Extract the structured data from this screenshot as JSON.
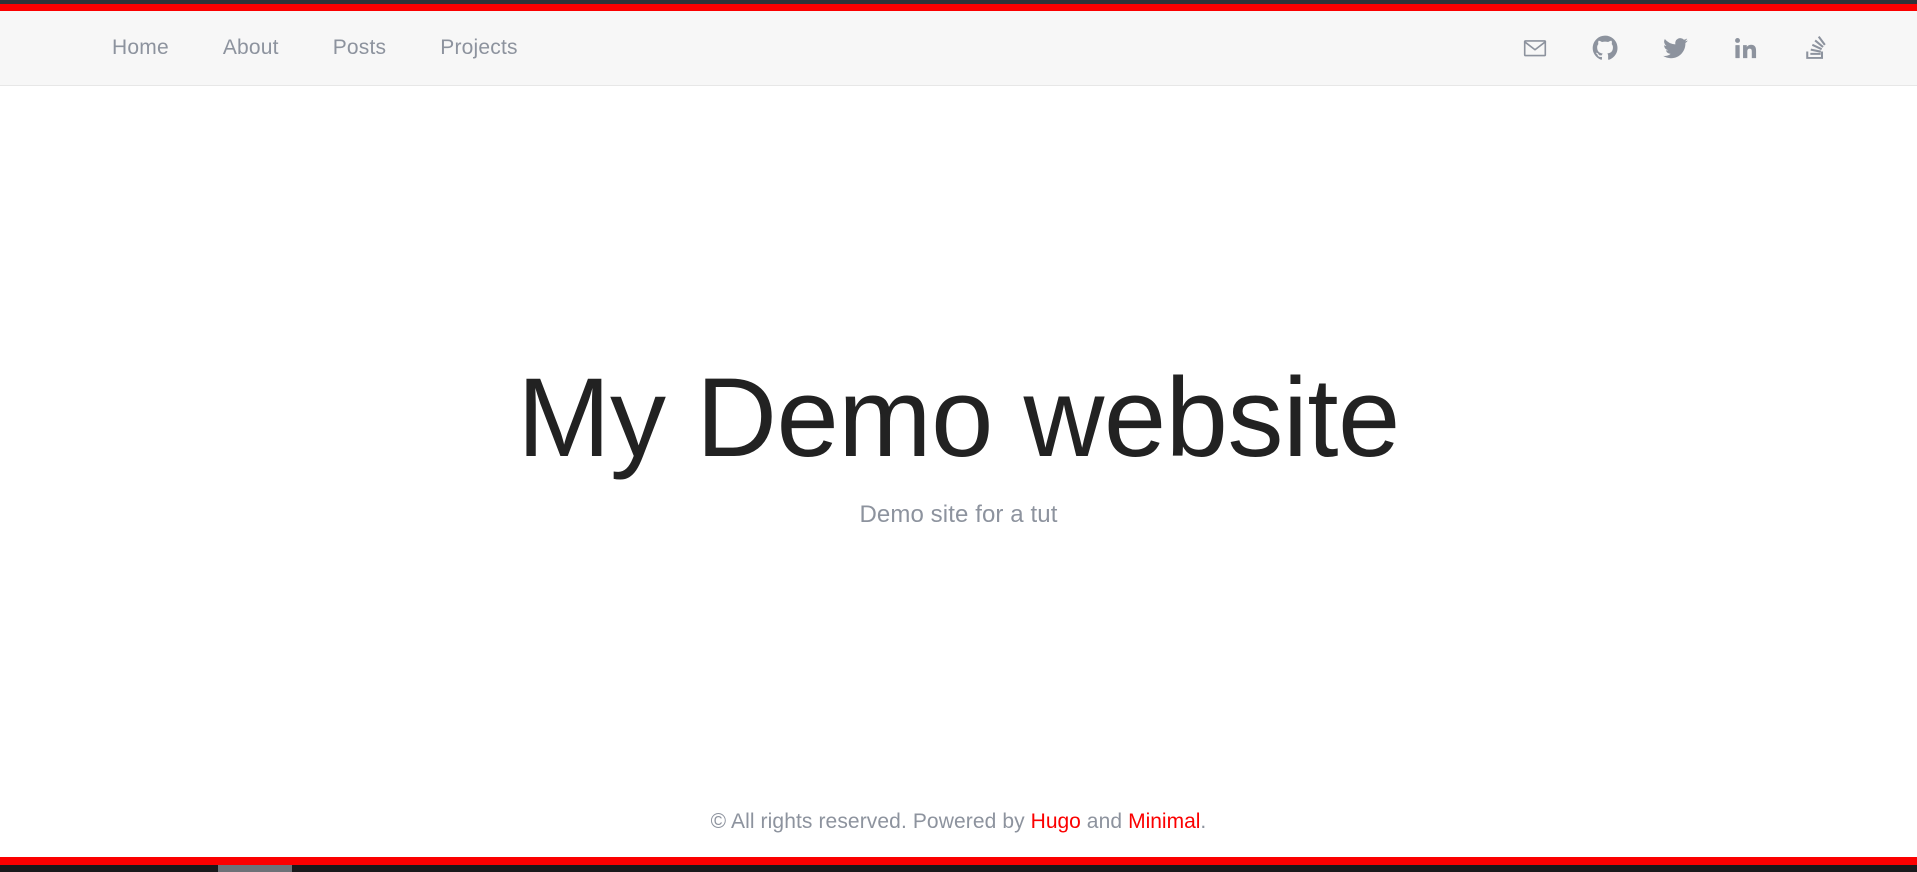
{
  "chrome": {
    "top_strip_color": "#2f3338",
    "accent_color": "#fb0000",
    "bottom_strip_color": "#19191b",
    "scroll_thumb_color": "#6d7278"
  },
  "header": {
    "background": "#f7f7f7",
    "nav": [
      {
        "label": "Home",
        "name": "nav-link-home"
      },
      {
        "label": "About",
        "name": "nav-link-about"
      },
      {
        "label": "Posts",
        "name": "nav-link-posts"
      },
      {
        "label": "Projects",
        "name": "nav-link-projects"
      }
    ],
    "social": [
      {
        "icon": "envelope-icon",
        "title": "Email"
      },
      {
        "icon": "github-icon",
        "title": "GitHub"
      },
      {
        "icon": "twitter-icon",
        "title": "Twitter"
      },
      {
        "icon": "linkedin-icon",
        "title": "LinkedIn"
      },
      {
        "icon": "stackoverflow-icon",
        "title": "Stack Overflow"
      }
    ],
    "social_color": "#8d939e"
  },
  "hero": {
    "title": "My Demo website",
    "subtitle": "Demo site for a tut",
    "title_color": "#222222",
    "subtitle_color": "#8d939e"
  },
  "footer": {
    "prefix": "© All rights reserved. Powered by ",
    "link_one": "Hugo",
    "middle": " and ",
    "link_two": "Minimal",
    "suffix": ".",
    "link_color": "#fb0000",
    "text_color": "#8d939e"
  }
}
